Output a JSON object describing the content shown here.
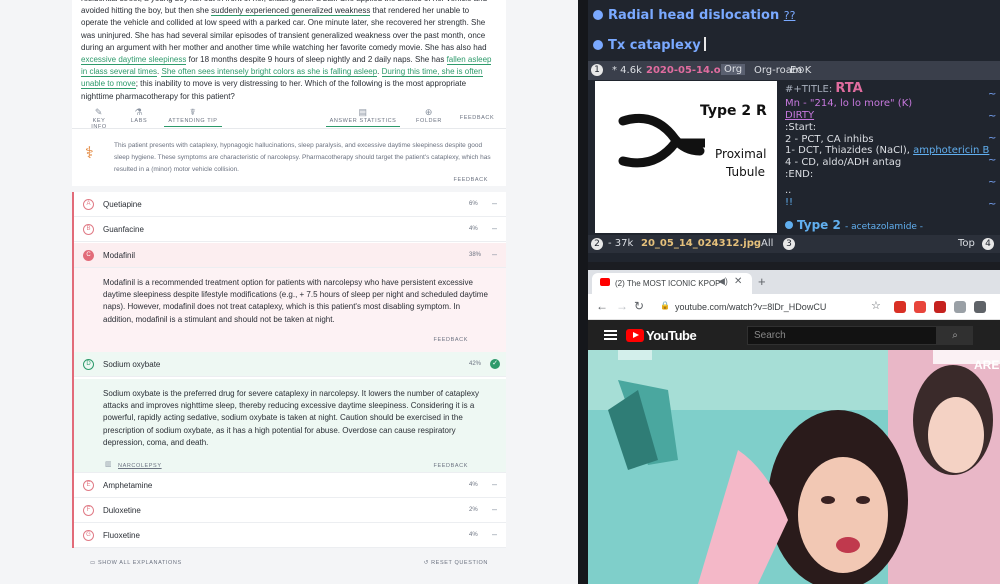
{
  "question": {
    "stem_parts": [
      {
        "t": "residential street, a young boy ran out in front of her, chasing after a ball. She applied the brakes of her vehicle and avoided hitting the boy, but then she ",
        "s": ""
      },
      {
        "t": "suddenly experienced generalized weakness",
        "s": "u"
      },
      {
        "t": " that rendered her unable to operate the vehicle and collided at low speed with a parked car. One minute later, she recovered her strength. She was uninjured. She has had several similar episodes of transient generalized weakness over the past month, once during an argument with her mother and another time while watching her favorite comedy movie. She has also had ",
        "s": ""
      },
      {
        "t": "excessive daytime sleepiness",
        "s": "ug"
      },
      {
        "t": " for 18 months despite 9 hours of sleep nightly and 2 daily naps. She has ",
        "s": ""
      },
      {
        "t": "fallen asleep in class several times",
        "s": "ug"
      },
      {
        "t": ". ",
        "s": ""
      },
      {
        "t": "She often sees intensely bright colors as she is falling asleep",
        "s": "ug"
      },
      {
        "t": ". ",
        "s": ""
      },
      {
        "t": "During this time, she is often unable to move",
        "s": "ug"
      },
      {
        "t": "; this inability to move is very distressing to her. Which of the following is the most appropriate nighttime pharmacotherapy for this patient?",
        "s": ""
      }
    ],
    "toolbar": {
      "key_info": "KEY INFO",
      "labs": "LABS",
      "attending_tip": "ATTENDING TIP",
      "answer_statistics": "ANSWER STATISTICS",
      "folder": "FOLDER",
      "feedback": "FEEDBACK"
    },
    "tip_text": "This patient presents with cataplexy, hypnagogic hallucinations, sleep paralysis, and excessive daytime sleepiness despite good sleep hygiene. These symptoms are characteristic of narcolepsy. Pharmacotherapy should target the patient's cataplexy, which has resulted in a (minor) motor vehicle collision.",
    "tip_feedback": "FEEDBACK"
  },
  "answers": [
    {
      "letter": "A",
      "label": "Quetiapine",
      "pct": "6%"
    },
    {
      "letter": "B",
      "label": "Guanfacine",
      "pct": "4%"
    },
    {
      "letter": "C",
      "label": "Modafinil",
      "pct": "38%"
    },
    {
      "letter": "D",
      "label": "Sodium oxybate",
      "pct": "42%"
    },
    {
      "letter": "E",
      "label": "Amphetamine",
      "pct": "4%"
    },
    {
      "letter": "F",
      "label": "Duloxetine",
      "pct": "2%"
    },
    {
      "letter": "G",
      "label": "Fluoxetine",
      "pct": "4%"
    }
  ],
  "explanation_wrong": "Modafinil is a recommended treatment option for patients with narcolepsy who have persistent excessive daytime sleepiness despite lifestyle modifications (e.g., + 7.5 hours of sleep per night and scheduled daytime naps). However, modafinil does not treat cataplexy, which is this patient's most disabling symptom. In addition, modafinil is a stimulant and should not be taken at night.",
  "explanation_right": "Sodium oxybate is the preferred drug for severe cataplexy in narcolepsy. It lowers the number of cataplexy attacks and improves nighttime sleep, thereby reducing excessive daytime sleepiness. Considering it is a powerful, rapidly acting sedative, sodium oxybate is taken at night. Caution should be exercised in the prescription of sodium oxybate, as it has a high potential for abuse. Overdose can cause respiratory depression, coma, and death.",
  "feedback_label": "FEEDBACK",
  "narcolepsy_link": "NARCOLEPSY",
  "bottom": {
    "show_all": "SHOW ALL EXPLANATIONS",
    "reset": "RESET QUESTION"
  },
  "emacs": {
    "heading1": "Radial head dislocation",
    "heading1_q": "??",
    "heading2": "Tx cataplexy",
    "modeline1": {
      "num": "1",
      "size": "* 4.6k",
      "file": "2020-05-14.org",
      "mode1": "Org",
      "mode2": "Org-roam",
      "extra": "E⊛K"
    },
    "image": {
      "title": "Type 2 R",
      "line1": "Proximal",
      "line2": "Tubule"
    },
    "org_lines": [
      {
        "t": "#+TITLE: ",
        "k": "c",
        "t2": "RTA"
      },
      {
        "t": "Mn - \"214, lo lo more\" (K)",
        "k": "v"
      },
      {
        "t": "DIRTY",
        "k": "l"
      },
      {
        "t": ":Start:",
        "k": "w"
      },
      {
        "t": "2 - PCT, CA inhibs",
        "k": "w"
      },
      {
        "t": "1- DCT, Thiazides (NaCl), ",
        "k": "w",
        "t2": "amphotericin B"
      },
      {
        "t": "4 - CD, aldo/ADH antag",
        "k": "w"
      },
      {
        "t": ":END:",
        "k": "w"
      },
      {
        "t": "..",
        "k": "w"
      },
      {
        "t": "!!",
        "k": "w"
      }
    ],
    "heading3": "Type 2",
    "heading3_tail": "- acetazolamide -",
    "modeline2": {
      "num": "2",
      "size": "- 37k",
      "file": "20_05_14_024312.jpg",
      "pos": "All",
      "num3": "3",
      "top": "Top",
      "num4": "4"
    }
  },
  "browser": {
    "tab_title": "(2) The MOST ICONIC KPOP",
    "url": "youtube.com/watch?v=8lDr_HDowCU",
    "logo_text": "YouTube",
    "search_placeholder": "Search",
    "video_caption": "ARE"
  }
}
